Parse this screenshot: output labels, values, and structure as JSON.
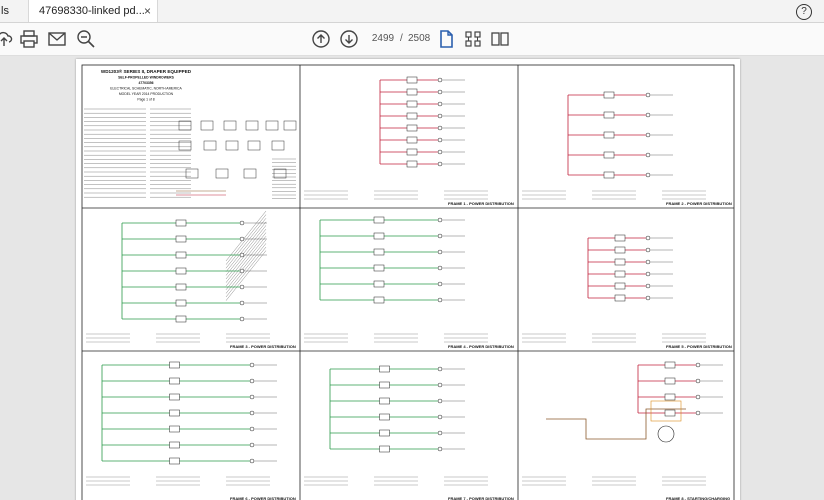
{
  "tabs": {
    "tools_label": "ls",
    "document_tab": "47698330-linked pd...",
    "close_symbol": "×",
    "help_symbol": "?"
  },
  "toolbar": {
    "icons": [
      "cloud-upload-icon",
      "print-icon",
      "email-icon",
      "zoom-out-icon",
      "page-up-icon",
      "page-down-icon",
      "select-tool-icon",
      "page-thumbnails-icon",
      "two-page-icon"
    ],
    "current_page": "2499",
    "separator": "/",
    "total_pages": "2508"
  },
  "document": {
    "title_lines": [
      "WD1203® SERIES II, DRAPER EQUIPPED",
      "SELF-PROPELLED WINDROWERS",
      "47703356",
      "ELECTRICAL SCHEMATIC, NORTH AMERICA",
      "MODEL YEAR 2014 PRODUCTION",
      "Page 1 of 8"
    ],
    "frame_labels": [
      "FRAME 1 - POWER DISTRIBUTION",
      "FRAME 2 - POWER DISTRIBUTION",
      "FRAME 3 - POWER DISTRIBUTION",
      "FRAME 4 - POWER DISTRIBUTION",
      "FRAME 5 - POWER DISTRIBUTION",
      "FRAME 6 - POWER DISTRIBUTION",
      "FRAME 7 - POWER DISTRIBUTION",
      "FRAME 8 - STARTING/CHARGING"
    ]
  },
  "colors": {
    "wire_red": "#c0223b",
    "wire_green": "#2a9a4a",
    "wire_brown": "#8b5a2b",
    "accent_blue": "#2b5fae"
  }
}
